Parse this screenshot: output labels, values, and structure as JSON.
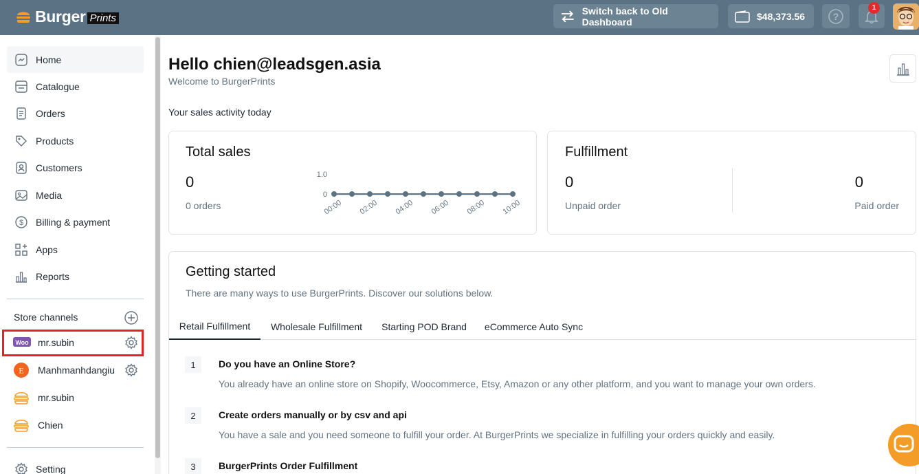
{
  "header": {
    "logo_main": "Burger",
    "logo_sub": "Prints",
    "switch_label": "Switch back to Old Dashboard",
    "balance": "$48,373.56",
    "notification_count": "1"
  },
  "sidebar": {
    "items": [
      {
        "label": "Home",
        "icon": "home-icon"
      },
      {
        "label": "Catalogue",
        "icon": "catalogue-icon"
      },
      {
        "label": "Orders",
        "icon": "orders-icon"
      },
      {
        "label": "Products",
        "icon": "tag-icon"
      },
      {
        "label": "Customers",
        "icon": "customer-icon"
      },
      {
        "label": "Media",
        "icon": "image-icon"
      },
      {
        "label": "Billing & payment",
        "icon": "dollar-icon"
      },
      {
        "label": "Apps",
        "icon": "apps-icon"
      },
      {
        "label": "Reports",
        "icon": "reports-icon"
      }
    ],
    "channels_title": "Store channels",
    "channels": [
      {
        "name": "mr.subin",
        "icon": "woocommerce-icon"
      },
      {
        "name": "Manhmanhdangiu",
        "icon": "etsy-icon"
      },
      {
        "name": "mr.subin",
        "icon": "burger-icon"
      },
      {
        "name": "Chien",
        "icon": "burger-icon"
      }
    ],
    "setting_label": "Setting"
  },
  "main": {
    "hello": "Hello chien@leadsgen.asia",
    "welcome": "Welcome to BurgerPrints",
    "activity": "Your sales activity today",
    "total_sales": {
      "title": "Total sales",
      "value": "0",
      "orders": "0 orders"
    },
    "fulfillment": {
      "title": "Fulfillment",
      "unpaid_value": "0",
      "unpaid_label": "Unpaid order",
      "paid_value": "0",
      "paid_label": "Paid order"
    },
    "getting_started": {
      "title": "Getting started",
      "subtitle": "There are many ways to use BurgerPrints. Discover our solutions below.",
      "tabs": [
        "Retail Fulfillment",
        "Wholesale Fulfillment",
        "Starting POD Brand",
        "eCommerce Auto Sync"
      ],
      "steps": [
        {
          "num": "1",
          "title": "Do you have an Online Store?",
          "desc": "You already have an online store on Shopify, Woocommerce, Etsy, Amazon or any other platform, and you want to manage your own orders."
        },
        {
          "num": "2",
          "title": "Create orders manually or by csv and api",
          "desc": "You have a sale and you need someone to fulfill your order. At BurgerPrints we specialize in fulfilling your orders quickly and easily."
        },
        {
          "num": "3",
          "title": "BurgerPrints Order Fulfillment",
          "desc": ""
        }
      ]
    }
  },
  "chart_data": {
    "type": "line",
    "x": [
      "00:00",
      "01:00",
      "02:00",
      "03:00",
      "04:00",
      "05:00",
      "06:00",
      "07:00",
      "08:00",
      "09:00",
      "10:00"
    ],
    "x_tick_labels": [
      "00:00",
      "02:00",
      "04:00",
      "06:00",
      "08:00",
      "10:00"
    ],
    "values": [
      0,
      0,
      0,
      0,
      0,
      0,
      0,
      0,
      0,
      0,
      0
    ],
    "y_tick_labels": [
      "1.0",
      "0"
    ],
    "ylim": [
      0,
      1
    ],
    "color": "#5a7283"
  },
  "colors": {
    "topbar": "#5a7283",
    "accent": "#f39c27",
    "highlight": "#e02424"
  }
}
